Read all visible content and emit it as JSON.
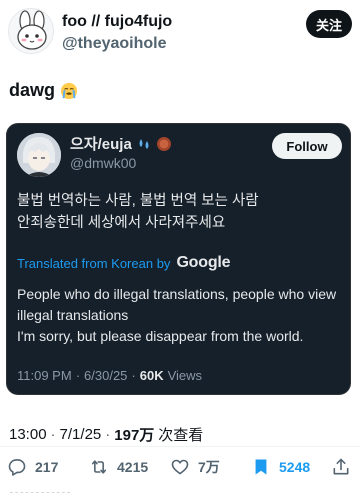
{
  "author": {
    "display_name": "foo // fujo4fujo",
    "handle": "@theyaoihole",
    "follow_label": "关注",
    "avatar_icon": "bunny-doodle-avatar-icon"
  },
  "tweet": {
    "text": "dawg",
    "emoji": "loudly-crying-face-icon"
  },
  "quote": {
    "display_name": "으자/euja",
    "name_emojis": [
      "sweat-droplets-icon",
      "round-badge-icon"
    ],
    "handle": "@dmwk00",
    "follow_label": "Follow",
    "original_text": "불법 번역하는 사람, 불법 번역 보는 사람\n안죄송한데 세상에서 사라져주세요",
    "translated_by_label": "Translated from Korean by",
    "translator_name": "Google",
    "translation_lines": [
      "People who do illegal translations, people who view illegal translations",
      "I'm sorry, but please disappear from the world."
    ],
    "time": "11:09 PM",
    "separator": "·",
    "date": "6/30/25",
    "views_count": "60K",
    "views_label": "Views",
    "theme": {
      "background": "#15202b",
      "text": "#e7e9ea",
      "muted": "#8b98a5",
      "link": "#1d9bf0"
    }
  },
  "meta": {
    "time": "13:00",
    "separator": "·",
    "date": "7/1/25",
    "separator2": "·",
    "views_count": "197万",
    "views_label": "次查看"
  },
  "actions": {
    "replies": "217",
    "retweets": "4215",
    "likes": "7万",
    "bookmarks": "5248"
  },
  "colors": {
    "accent": "#1d9bf0",
    "text": "#0f1419",
    "muted": "#536471"
  }
}
